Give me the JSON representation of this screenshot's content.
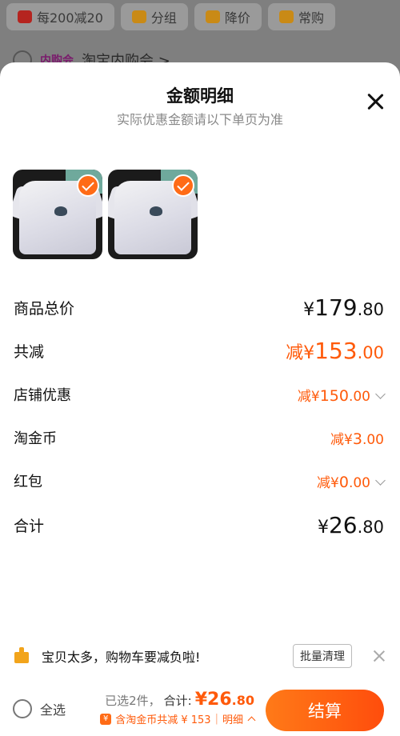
{
  "background": {
    "chips": [
      {
        "label": "每200减20",
        "icon": "coupon-icon",
        "color": "#b5241f"
      },
      {
        "label": "分组",
        "icon": "folder-icon",
        "color": "#c98a16"
      },
      {
        "label": "降价",
        "icon": "down-arrow-icon",
        "color": "#c98a16"
      },
      {
        "label": "常购",
        "icon": "cart-icon",
        "color": "#c98a16"
      }
    ],
    "store": {
      "badge": "内购会",
      "name": "淘宝内购会 >"
    }
  },
  "sheet": {
    "title": "金额明细",
    "subtitle": "实际优惠金额请以下单页为准",
    "close_icon": "close-icon"
  },
  "items": [
    {
      "selected": true,
      "image": "white-tshirt"
    },
    {
      "selected": true,
      "image": "white-tshirt"
    }
  ],
  "breakdown": {
    "total": {
      "label": "商品总价",
      "cur": "¥",
      "int": "179",
      "dec": ".80"
    },
    "reduced": {
      "label": "共减",
      "pre": "减",
      "cur": "¥",
      "int": "153",
      "dec": ".00"
    },
    "shop_discount": {
      "label": "店铺优惠",
      "pre": "减",
      "cur": "¥",
      "int": "150",
      "dec": ".00"
    },
    "coins": {
      "label": "淘金币",
      "pre": "减",
      "cur": "¥",
      "int": "3",
      "dec": ".00"
    },
    "red_packet": {
      "label": "红包",
      "pre": "减",
      "cur": "¥",
      "int": "0",
      "dec": ".00"
    },
    "sum": {
      "label": "合计",
      "cur": "¥",
      "int": "26",
      "dec": ".80"
    }
  },
  "tip": {
    "text": "宝贝太多，购物车要减负啦!",
    "button": "批量清理"
  },
  "checkout": {
    "select_all": "全选",
    "selected_count": "已选2件，",
    "total_label": "合计:",
    "total_int": "¥26",
    "total_dec": ".80",
    "coin_badge": "¥",
    "detail_text": "含淘金币共减 ¥ 153",
    "detail_sep": "|",
    "detail_link": "明细",
    "pay_button": "结算"
  },
  "colors": {
    "accent": "#ff5a0a",
    "check": "#ff6b16",
    "tip_icon": "#f2a41b"
  }
}
